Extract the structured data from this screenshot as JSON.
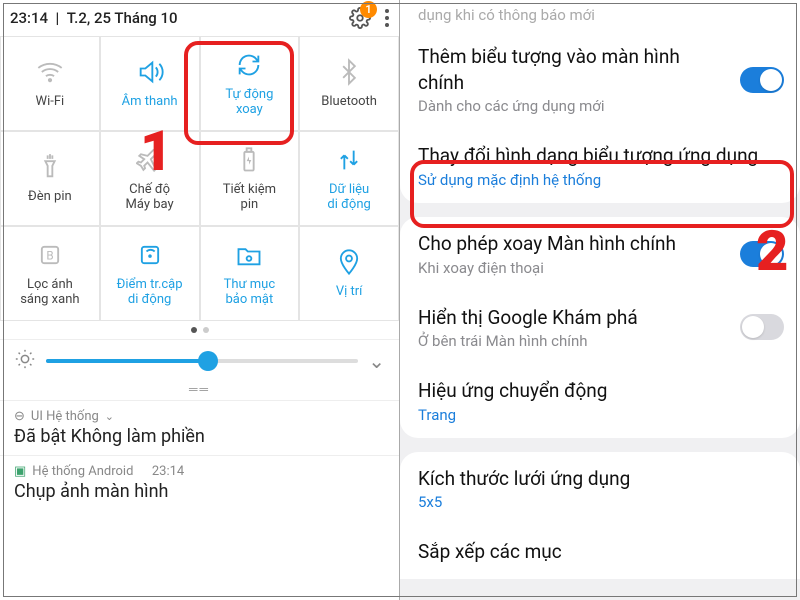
{
  "status": {
    "time": "23:14",
    "sep": "|",
    "date": "T.2, 25 Tháng 10",
    "badge": "1"
  },
  "tiles": [
    {
      "label": "Wi-Fi"
    },
    {
      "label": "Âm thanh"
    },
    {
      "label": "Tự động\nxoay"
    },
    {
      "label": "Bluetooth"
    },
    {
      "label": "Đèn pin"
    },
    {
      "label": "Chế độ\nMáy bay"
    },
    {
      "label": "Tiết kiệm\npin"
    },
    {
      "label": "Dữ liệu\ndi động"
    },
    {
      "label": "Lọc ánh\nsáng xanh"
    },
    {
      "label": "Điểm tr.cập\ndi động"
    },
    {
      "label": "Thư mục\nbảo mật"
    },
    {
      "label": "Vị trí"
    }
  ],
  "tileActive": [
    1,
    2,
    7,
    9,
    10,
    11
  ],
  "notif1": {
    "head": "UI Hệ thống",
    "title": "Đã bật Không làm phiền"
  },
  "notif2": {
    "head": "Hệ thống Android",
    "time": "23:14",
    "title": "Chụp ảnh màn hình"
  },
  "marks": {
    "one": "1",
    "two": "2"
  },
  "right": {
    "cut": "dụng khi có thông báo mới",
    "r1": {
      "t": "Thêm biểu tượng vào màn hình chính",
      "s": "Dành cho các ứng dụng mới",
      "toggle": true
    },
    "r2": {
      "t": "Thay đổi hình dạng biểu tượng ứng dụng",
      "s": "Sử dụng mặc định hệ thống"
    },
    "r3": {
      "t": "Cho phép xoay Màn hình chính",
      "s": "Khi xoay điện thoại",
      "toggle": true
    },
    "r4": {
      "t": "Hiển thị Google Khám phá",
      "s": "Ở bên trái Màn hình chính",
      "toggle": false
    },
    "r5": {
      "t": "Hiệu ứng chuyển động",
      "s": "Trang"
    },
    "r6": {
      "t": "Kích thước lưới ứng dụng",
      "s": "5x5"
    },
    "r7": {
      "t": "Sắp xếp các mục"
    }
  }
}
